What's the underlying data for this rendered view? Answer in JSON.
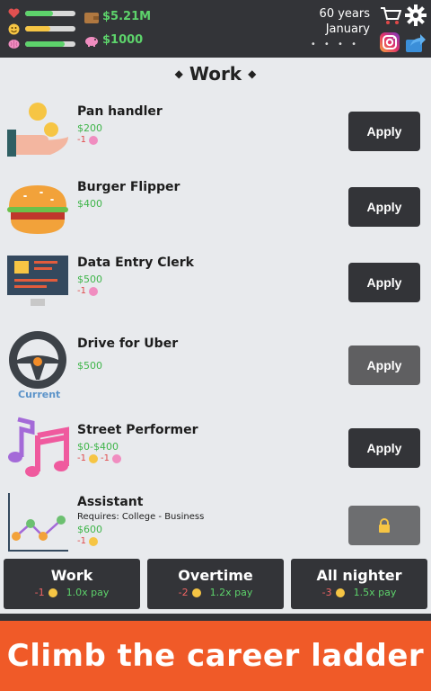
{
  "header": {
    "stats": [
      {
        "icon": "heart-icon",
        "level": 0.55,
        "color": "#5dd36b"
      },
      {
        "icon": "smiley-icon",
        "level": 0.5,
        "color": "#f6c544"
      },
      {
        "icon": "brain-icon",
        "level": 0.78,
        "color": "#5dd36b"
      }
    ],
    "cash": "$5.21M",
    "savings": "$1000",
    "age": "60 years",
    "month": "January",
    "page_dots": "• • • •"
  },
  "section_title": "Work",
  "title_diamond": "◆",
  "jobs": [
    {
      "name": "Pan handler",
      "pay": "$200",
      "cost": "-1",
      "cost_icons": [
        "brain-icon"
      ],
      "button": "Apply"
    },
    {
      "name": "Burger Flipper",
      "pay": "$400",
      "button": "Apply"
    },
    {
      "name": "Data Entry Clerk",
      "pay": "$500",
      "cost": "-1",
      "cost_icons": [
        "brain-icon"
      ],
      "button": "Apply"
    },
    {
      "name": "Drive for Uber",
      "pay": "$500",
      "button": "Apply",
      "status": "Current"
    },
    {
      "name": "Street Performer",
      "pay": "$0-$400",
      "cost_a": "-1",
      "cost_b": "-1",
      "cost_icons": [
        "smiley-icon",
        "brain-icon"
      ],
      "button": "Apply"
    },
    {
      "name": "Assistant",
      "requirement": "Requires: College - Business",
      "pay": "$600",
      "cost": "-1",
      "cost_icons": [
        "smiley-icon"
      ],
      "button_icon": "lock-icon"
    }
  ],
  "actions": [
    {
      "label": "Work",
      "cost": "-1",
      "multiplier": "1.0x pay"
    },
    {
      "label": "Overtime",
      "cost": "-2",
      "multiplier": "1.2x pay"
    },
    {
      "label": "All nighter",
      "cost": "-3",
      "multiplier": "1.5x pay"
    }
  ],
  "promo": "Climb the career ladder"
}
